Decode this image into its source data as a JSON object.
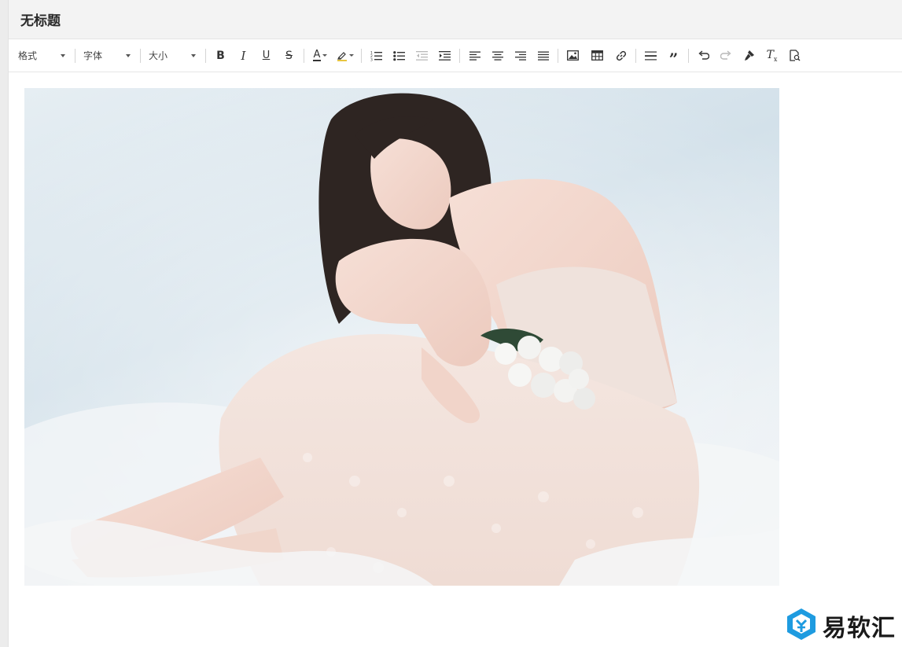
{
  "document": {
    "title": "无标题"
  },
  "toolbar": {
    "format_label": "格式",
    "font_label": "字体",
    "size_label": "大小",
    "bold_glyph": "B",
    "italic_glyph": "I",
    "underline_glyph": "U",
    "strike_glyph": "S",
    "text_color_glyph": "A",
    "highlight_glyph": "A",
    "clear_format_glyph": "T",
    "clear_format_sub": "x",
    "quote_glyph": "”"
  },
  "icons": [
    "ordered-list-icon",
    "bullet-list-icon",
    "outdent-icon",
    "indent-icon",
    "align-left-icon",
    "align-center-icon",
    "align-right-icon",
    "align-justify-icon",
    "image-icon",
    "table-icon",
    "link-icon",
    "horizontal-rule-icon",
    "blockquote-icon",
    "undo-icon",
    "redo-icon",
    "format-painter-icon",
    "clear-format-icon",
    "preview-icon"
  ],
  "colors": {
    "accent_blue": "#1e9be0",
    "highlight_yellow": "#e8c540",
    "disabled_gray": "#b9b9b9"
  },
  "watermark": {
    "text": "易软汇"
  }
}
